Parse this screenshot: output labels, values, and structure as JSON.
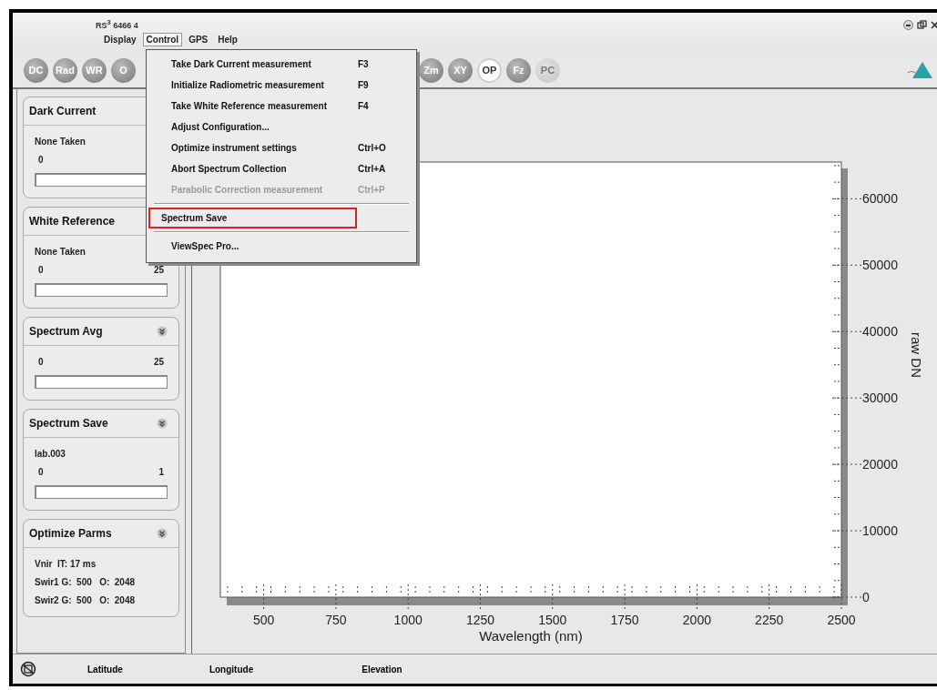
{
  "window": {
    "title": "RS$^{3}$ 6466 4"
  },
  "menu_bar": [
    {
      "label": "Display",
      "selected": false
    },
    {
      "label": "Control",
      "selected": true
    },
    {
      "label": "GPS",
      "selected": false
    },
    {
      "label": "Help",
      "selected": false
    }
  ],
  "toolbar": [
    {
      "label": "DC",
      "selected": false,
      "disabled": false
    },
    {
      "label": "Rad",
      "selected": false,
      "disabled": false
    },
    {
      "label": "WR",
      "selected": false,
      "disabled": false
    },
    {
      "label": "O",
      "selected": false,
      "disabled": false
    },
    {
      "label": "Zm",
      "selected": false,
      "disabled": false
    },
    {
      "label": "XY",
      "selected": false,
      "disabled": false
    },
    {
      "label": "OP",
      "selected": true,
      "disabled": false
    },
    {
      "label": "Fz",
      "selected": false,
      "disabled": false
    },
    {
      "label": "PC",
      "selected": false,
      "disabled": true
    }
  ],
  "control_menu": [
    {
      "kind": "item",
      "label": "Take Dark Current measurement",
      "shortcut": "F3",
      "disabled": false,
      "highlighted": false
    },
    {
      "kind": "item",
      "label": "Initialize Radiometric measurement",
      "shortcut": "F9",
      "disabled": false,
      "highlighted": false
    },
    {
      "kind": "item",
      "label": "Take White Reference measurement",
      "shortcut": "F4",
      "disabled": false,
      "highlighted": false
    },
    {
      "kind": "item",
      "label": "Adjust Configuration...",
      "disabled": false,
      "highlighted": false
    },
    {
      "kind": "item",
      "label": "Optimize instrument settings",
      "shortcut": "Ctrl+O",
      "disabled": false,
      "highlighted": false
    },
    {
      "kind": "item",
      "label": "Abort Spectrum Collection",
      "shortcut": "Ctrl+A",
      "disabled": false,
      "highlighted": false
    },
    {
      "kind": "item",
      "label": "Parabolic Correction measurement",
      "shortcut": "Ctrl+P",
      "disabled": true,
      "highlighted": false
    },
    {
      "kind": "separator"
    },
    {
      "kind": "item",
      "label": "Spectrum Save",
      "disabled": false,
      "highlighted": true
    },
    {
      "kind": "separator"
    },
    {
      "kind": "item",
      "label": "ViewSpec Pro...",
      "disabled": false,
      "highlighted": false
    }
  ],
  "panels": [
    {
      "title": "Dark Current",
      "status": "None Taken",
      "min": "0",
      "level": 0
    },
    {
      "title": "White Reference",
      "status": "None Taken",
      "min": "0",
      "max": "25",
      "level": 0
    },
    {
      "title": "Spectrum Avg",
      "collapsible": true,
      "min": "0",
      "max": "25",
      "level": 0
    },
    {
      "title": "Spectrum Save",
      "collapsible": true,
      "status": "lab.003",
      "min": "0",
      "max": "1",
      "level": 0
    },
    {
      "title": "Optimize Parms",
      "collapsible": true,
      "lines": [
        "Vnir  IT: 17 ms",
        "Swir1 G:  500   O:  2048",
        "Swir2 G:  500   O:  2048"
      ]
    }
  ],
  "chart": {
    "chart_data": {
      "type": "line",
      "xlabel": "Wavelength (nm)",
      "ylabel": "raw DN",
      "xlim": [
        350,
        2500
      ],
      "ylim": [
        0,
        65535
      ],
      "xticks": [
        500,
        750,
        1000,
        1250,
        1500,
        1750,
        2000,
        2250,
        2500
      ],
      "yticks": [
        0,
        10000,
        20000,
        30000,
        40000,
        50000,
        60000
      ]
    }
  },
  "status_bar": [
    "Latitude",
    "Longitude",
    "Elevation"
  ]
}
